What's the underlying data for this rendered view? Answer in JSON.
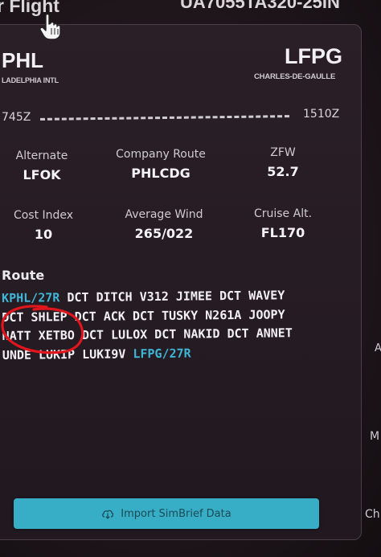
{
  "header": {
    "title": "r Flight",
    "aircraft_id": "UA7055TA320-25IN"
  },
  "departure": {
    "code": "PHL",
    "name": "LADELPHIA INTL",
    "time": "745Z"
  },
  "arrival": {
    "code": "LFPG",
    "name": "CHARLES-DE-GAULLE",
    "time": "1510Z"
  },
  "info_row1": [
    {
      "label": "Alternate",
      "value": "LFOK"
    },
    {
      "label": "Company Route",
      "value": "PHLCDG"
    },
    {
      "label": "ZFW",
      "value": "52.7"
    }
  ],
  "info_row2": [
    {
      "label": "Cost Index",
      "value": "10"
    },
    {
      "label": "Average Wind",
      "value": "265/022"
    },
    {
      "label": "Cruise Alt.",
      "value": "FL170"
    }
  ],
  "route": {
    "label": "Route",
    "origin": "KPHL/27R",
    "line1_rest": " DCT DITCH V312 JIMEE DCT WAVEY",
    "line2": "DCT SHLEP DCT ACK DCT TUSKY N261A JOOPY",
    "line3": "NATT XETBO DCT LULOX DCT NAKID DCT ANNET",
    "line4_start": "UNDE LUKIP LUKI9V ",
    "destination": "LFPG/27R"
  },
  "import_button": {
    "label": "Import SimBrief Data",
    "icon": "cloud-download-icon"
  },
  "edge_fragments": {
    "a": "A",
    "m": "M",
    "c": "Ch"
  },
  "colors": {
    "accent": "#37aec6",
    "highlight_text": "#3fb6d6",
    "annotation": "#e0161d",
    "panel": "#251b22"
  }
}
